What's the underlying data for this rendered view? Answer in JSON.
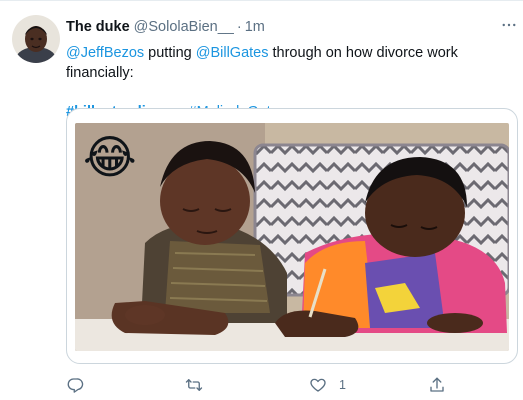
{
  "tweet": {
    "author_name": "The duke",
    "author_handle": "@SololaBien__",
    "separator": "·",
    "timestamp": "1m",
    "text_segments": [
      {
        "text": "@JeffBezos",
        "type": "mention"
      },
      {
        "text": " putting ",
        "type": "plain"
      },
      {
        "text": "@BillGates",
        "type": "mention"
      },
      {
        "text": " through on how divorce work financially:",
        "type": "plain"
      }
    ],
    "hashtags": [
      "#billgatesdivorce",
      "#MelindaGates"
    ],
    "media": {
      "emoji": "😂",
      "kind": "gif-still"
    },
    "actions": {
      "reply_icon": "reply-icon",
      "retweet_icon": "retweet-icon",
      "like_icon": "heart-icon",
      "like_count": "1",
      "share_icon": "share-icon"
    },
    "more_icon": "more-icon"
  },
  "colors": {
    "link": "#1b95e0",
    "secondary_text": "#5b7083",
    "primary_text": "#0f1419",
    "border": "#ccd6dd"
  }
}
